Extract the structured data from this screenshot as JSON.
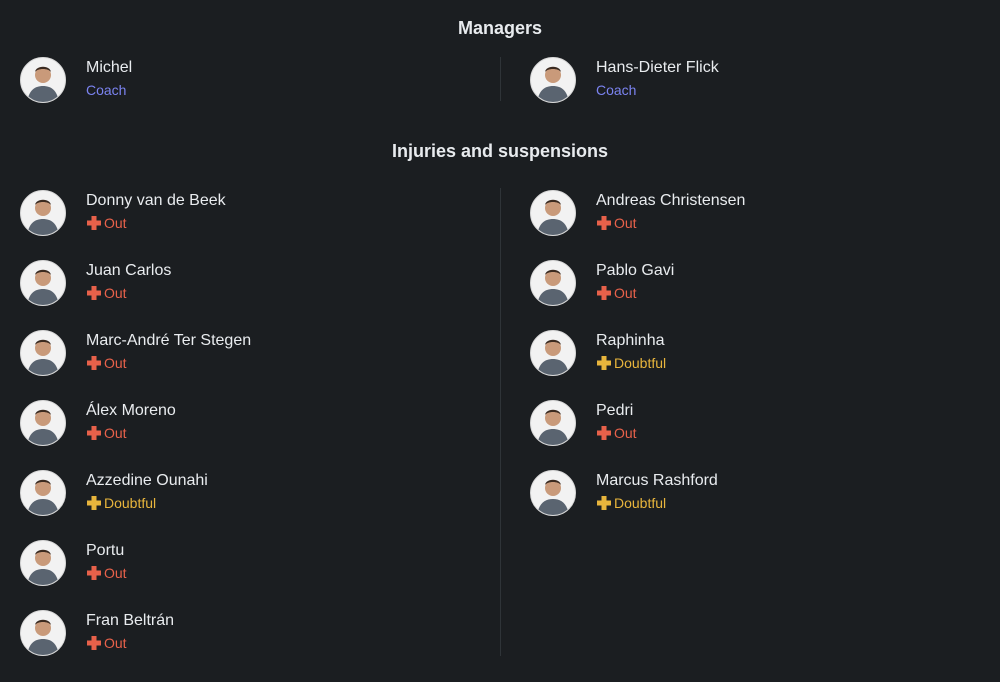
{
  "managers": {
    "title": "Managers",
    "items": [
      {
        "name": "Michel",
        "role": "Coach"
      },
      {
        "name": "Hans-Dieter Flick",
        "role": "Coach"
      }
    ]
  },
  "injuries": {
    "title": "Injuries and suspensions",
    "left": [
      {
        "name": "Donny van de Beek",
        "status": "Out"
      },
      {
        "name": "Juan Carlos",
        "status": "Out"
      },
      {
        "name": "Marc-André Ter Stegen",
        "status": "Out"
      },
      {
        "name": "Álex Moreno",
        "status": "Out"
      },
      {
        "name": "Azzedine Ounahi",
        "status": "Doubtful"
      },
      {
        "name": "Portu",
        "status": "Out"
      },
      {
        "name": "Fran Beltrán",
        "status": "Out"
      }
    ],
    "right": [
      {
        "name": "Andreas Christensen",
        "status": "Out"
      },
      {
        "name": "Pablo Gavi",
        "status": "Out"
      },
      {
        "name": "Raphinha",
        "status": "Doubtful"
      },
      {
        "name": "Pedri",
        "status": "Out"
      },
      {
        "name": "Marcus Rashford",
        "status": "Doubtful"
      }
    ]
  },
  "colors": {
    "background": "#1b1e21",
    "coach": "#7b83f0",
    "out": "#e8614a",
    "doubtful": "#e8b53c"
  },
  "icons": {
    "avatar": "person-avatar-icon",
    "status": "medical-cross-icon"
  }
}
